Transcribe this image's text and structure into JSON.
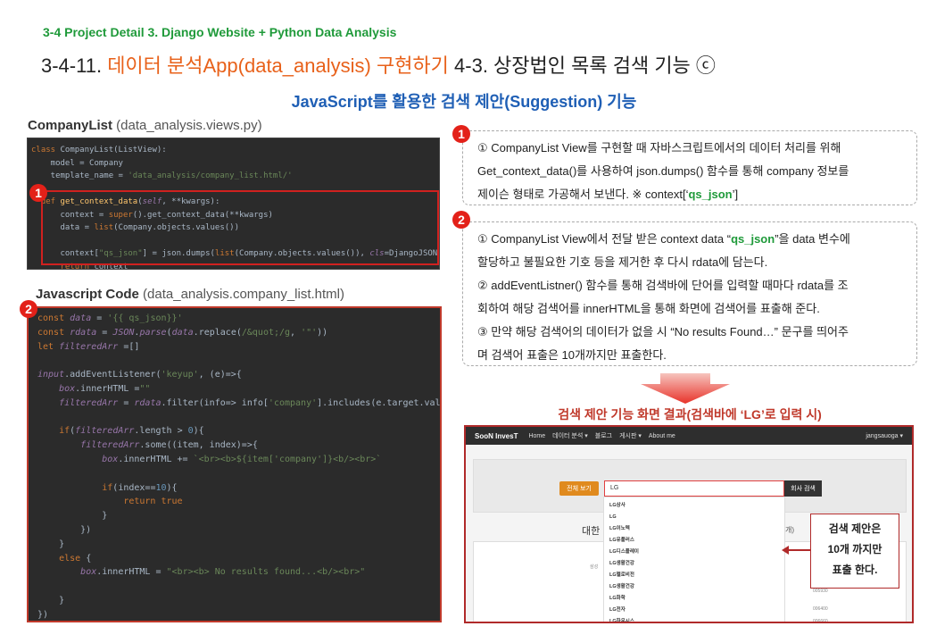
{
  "header": {
    "crumb": "3-4 Project Detail 3. Django Website + Python Data Analysis",
    "title_prefix": "3-4-11. ",
    "title_highlight1": "데이터 분석App(data_analysis)",
    "title_highlight2": " 구현하기",
    "title_suffix": " 4-3. 상장법인 목록 검색 기능 ⓒ",
    "subtitle": "JavaScript를 활용한 검색 제안(Suggestion) 기능"
  },
  "section1": {
    "label_bold": "CompanyList",
    "label_rest": " (data_analysis.views.py)",
    "badge": "1"
  },
  "section2": {
    "label_bold": "Javascript Code",
    "label_rest": " (data_analysis.company_list.html)",
    "badge": "2"
  },
  "notes": {
    "n1_badge": "1",
    "n1_l1": "① CompanyList View를 구현할 때 자바스크립트에서의 데이터 처리를 위해",
    "n1_l2": "Get_context_data()를 사용하여 json.dumps() 함수를 통해 company 정보를",
    "n1_l3a": "제이슨 형태로 가공해서 보낸다. ※ context[‘",
    "n1_l3g": "qs_json",
    "n1_l3b": "’]",
    "n2_badge": "2",
    "n2_l1a": "① CompanyList View에서 전달 받은 context data “",
    "n2_l1g": "qs_json",
    "n2_l1b": "”을 data 변수에",
    "n2_l2": "할당하고 불필요한 기호 등을 제거한 후 다시 rdata에 담는다.",
    "n2_l3": "② addEventListner() 함수를 통해 검색바에 단어를 입력할 때마다 rdata를 조",
    "n2_l4": "회하여 해당 검색어를 innerHTML을 통해 화면에 검색어를 표출해 준다.",
    "n2_l5": "③ 만약 해당 검색어의 데이터가 없을 시 “No results Found…” 문구를 띄어주",
    "n2_l6": "며 검색어 표출은 10개까지만 표출한다."
  },
  "result": {
    "title": "검색 제안 기능 화면 결과(검색바에 ‘LG’로 입력 시)",
    "nav": {
      "brand": "SooN InvesT",
      "items": [
        "Home",
        "데이터 분석 ▾",
        "블로그",
        "게시판 ▾",
        "About me"
      ],
      "user": "jangsauoga ▾"
    },
    "btn_left": "전체 보기",
    "search_value": "LG",
    "btn_search": "회사 검색",
    "table_title": "대한",
    "table_title2": "개)",
    "suggestions": [
      "LG상사",
      "LG",
      "LG이노텍",
      "LG유플러스",
      "LG디스플레이",
      "LG생활건강",
      "LG헬로비전",
      "LG생활건강",
      "LG화학",
      "LG전자",
      "LG하우시스"
    ],
    "table_cells": [
      "삼성",
      "005930",
      "006400",
      "006660"
    ]
  },
  "callout": {
    "l1": "검색 제안은",
    "l2": "10개 까지만",
    "l3": "표출 한다."
  },
  "colors": {
    "accent_green": "#1f9a3a",
    "accent_orange": "#e8611a",
    "accent_blue": "#1f5fb5",
    "badge_red": "#e32119"
  }
}
